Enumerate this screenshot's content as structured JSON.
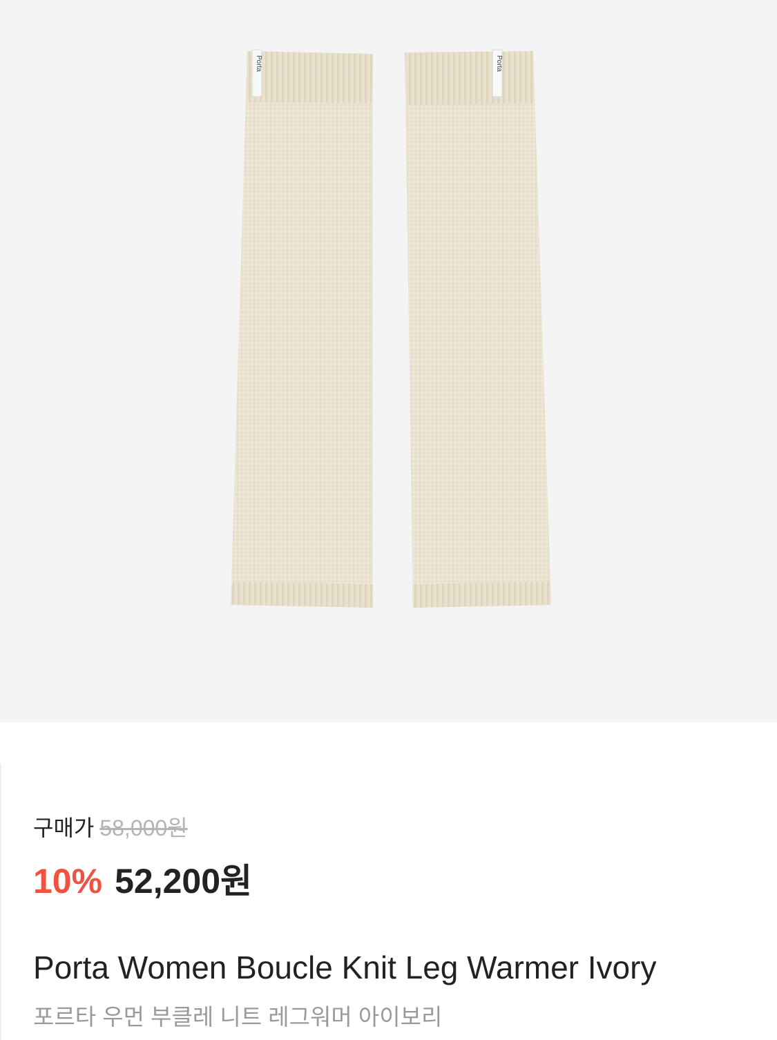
{
  "product": {
    "image_alt": "Porta Women Boucle Knit Leg Warmer Ivory",
    "brand_tag": "Porta",
    "colors": {
      "background": "#f4f4f4",
      "knit": "#ece4d2",
      "knit_shadow": "#ddd3bd",
      "discount": "#ef5241",
      "text": "#222222",
      "muted": "#9a9a9a"
    }
  },
  "price": {
    "label": "구매가",
    "original": "58,000원",
    "discount": "10%",
    "sale": "52,200원"
  },
  "title": {
    "en": "Porta Women Boucle Knit Leg Warmer Ivory",
    "ko": "포르타 우먼 부클레 니트 레그워머 아이보리"
  }
}
